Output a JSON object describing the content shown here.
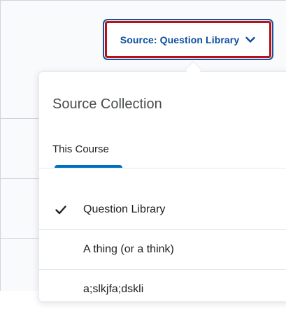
{
  "source_button": {
    "label": "Source: Question Library",
    "icon": "chevron-down-icon",
    "accent_color": "#0b4e9f",
    "focus_ring_color": "#b5121b"
  },
  "dropdown": {
    "title": "Source Collection",
    "tabs": [
      {
        "label": "This Course",
        "selected": true
      }
    ],
    "tab_indicator_color": "#006fbf",
    "items": [
      {
        "label": "Question Library",
        "checked": true,
        "icon": "checkmark-icon"
      },
      {
        "label": "A thing (or a think)",
        "checked": false
      },
      {
        "label": "a;slkjfa;dskli",
        "checked": false
      }
    ]
  }
}
